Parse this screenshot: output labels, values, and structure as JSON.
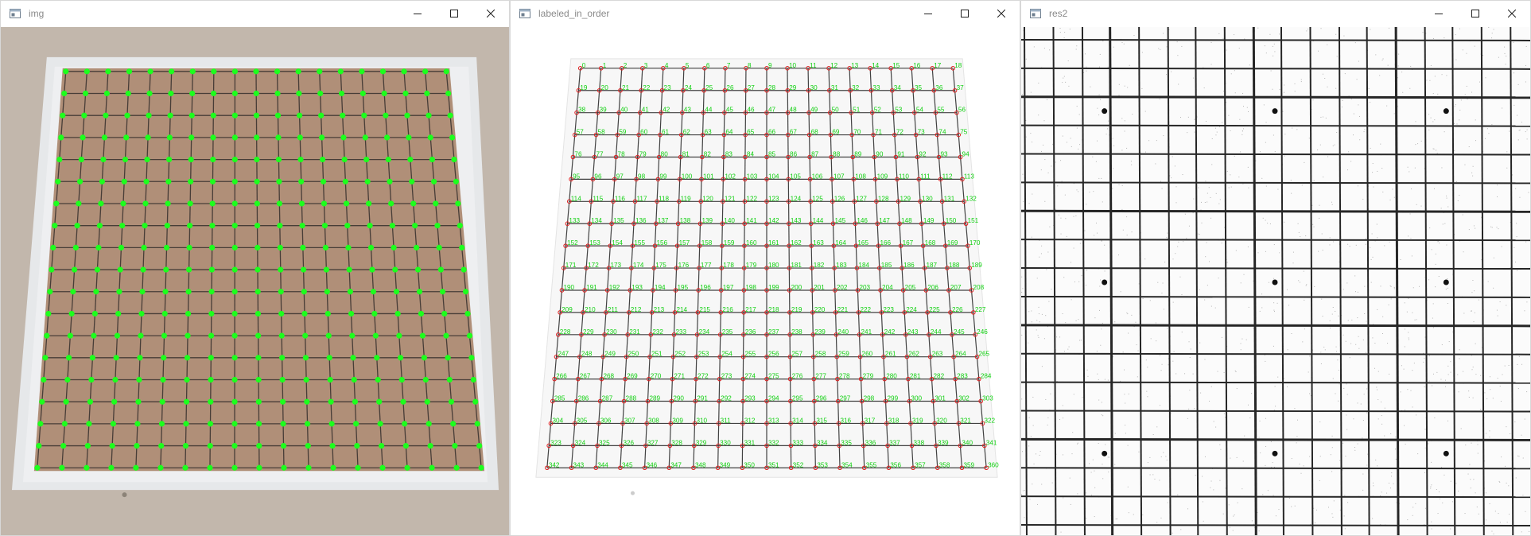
{
  "windows": [
    {
      "title": "img",
      "icon": "opencv-window-icon"
    },
    {
      "title": "labeled_in_order",
      "icon": "opencv-window-icon"
    },
    {
      "title": "res2",
      "icon": "opencv-window-icon"
    }
  ],
  "window_controls": [
    "minimize-icon",
    "maximize-icon",
    "close-icon"
  ],
  "grid": {
    "rows": 19,
    "cols": 19,
    "first_label": 0,
    "last_label": 360
  },
  "colors": {
    "point_green": "#1dff1d",
    "label_green": "#10d010",
    "marker_red": "#e02020",
    "board_brown": "#b08f78",
    "grid_line": "#222222"
  }
}
